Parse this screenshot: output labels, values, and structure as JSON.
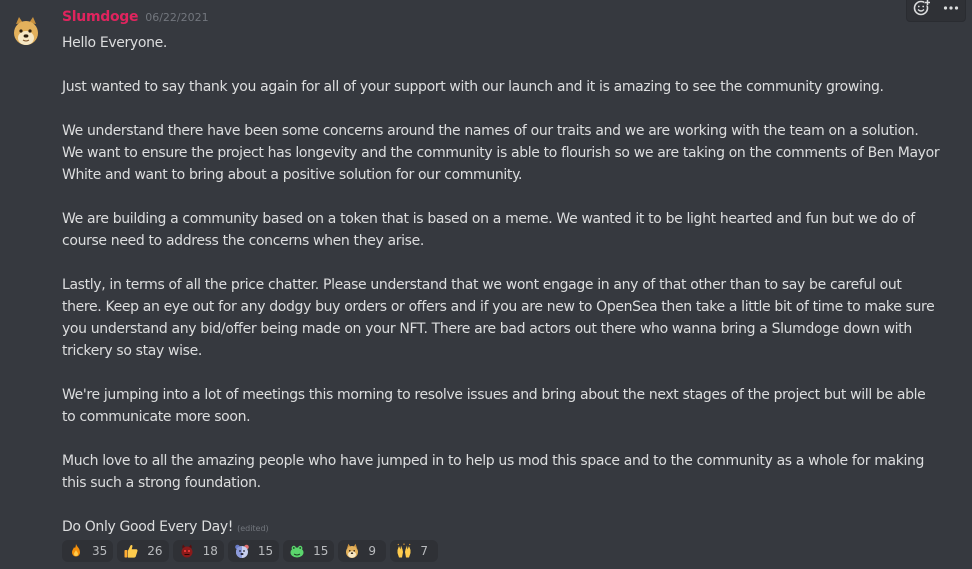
{
  "author": {
    "username": "Slumdoge",
    "timestamp": "06/22/2021"
  },
  "message": {
    "paragraphs": [
      "Hello Everyone.",
      "Just wanted to say thank you again for all of your support with our launch and it is amazing to see the community growing.",
      "We understand there have been some concerns around the names of our traits and we are working with the team on a solution. We want to ensure the project has longevity and the community is able to flourish so we are taking on the comments of Ben Mayor White and want to bring about a positive solution for our community.",
      "We are building a community based on a token that is based on a meme. We wanted it to be light hearted and fun but we do of course need to address the concerns when they arise.",
      "Lastly, in terms of all the price chatter. Please understand that we wont engage in any of that other than to say be careful out there. Keep an eye out for any dodgy buy orders or offers and if you are new to OpenSea then take a little bit of time to make sure you understand any bid/offer being made on your NFT. There are bad actors out there who wanna bring a Slumdoge down with trickery so stay wise.",
      "We're jumping into a lot of meetings this morning to resolve issues and bring about the next stages of the project but will be able to communicate more soon.",
      "Much love to all the amazing people who have jumped in to help us mod this space and to the community as a whole for making this such a strong foundation.",
      "Do Only Good Every Day!"
    ],
    "edited_label": "(edited)"
  },
  "toolbar": {
    "add_reaction_icon": "add-reaction-icon",
    "more_icon": "more-options-icon"
  },
  "reactions": [
    {
      "icon": "fire-emoji",
      "count": "35"
    },
    {
      "icon": "thumbs-up-emoji",
      "count": "26"
    },
    {
      "icon": "red-creature-emoji",
      "count": "18"
    },
    {
      "icon": "bear-emoji",
      "count": "15"
    },
    {
      "icon": "green-frog-emoji",
      "count": "15"
    },
    {
      "icon": "doge-emoji",
      "count": "9"
    },
    {
      "icon": "raised-hands-emoji",
      "count": "7"
    }
  ]
}
